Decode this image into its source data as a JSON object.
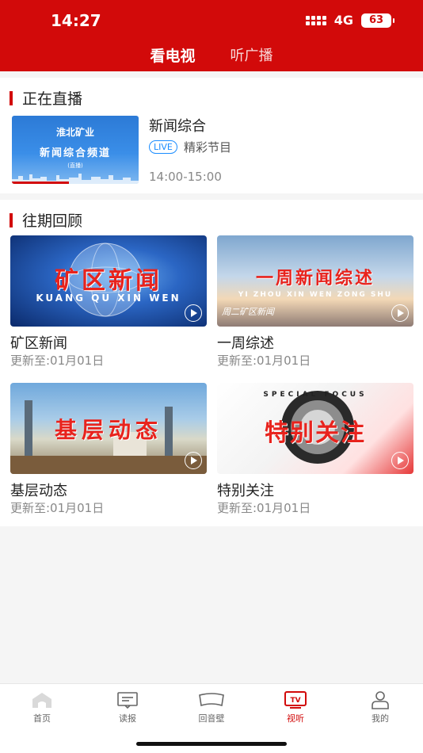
{
  "status_bar": {
    "time": "14:27",
    "network": "4G",
    "battery": "63"
  },
  "header": {
    "tabs": [
      {
        "label": "看电视",
        "active": true
      },
      {
        "label": "听广播",
        "active": false
      }
    ]
  },
  "live": {
    "section_title": "正在直播",
    "thumb": {
      "logo_text": "淮北矿业",
      "channel_text": "新闻综合频道",
      "sub_text": "(直播)"
    },
    "name": "新闻综合",
    "badge": "LIVE",
    "desc": "精彩节目",
    "time": "14:00-15:00"
  },
  "archive": {
    "section_title": "往期回顾",
    "items": [
      {
        "title": "矿区新闻",
        "update": "更新至:01月01日",
        "thumb_title": "矿区新闻",
        "thumb_sub": "KUANG QU XIN WEN"
      },
      {
        "title": "一周综述",
        "update": "更新至:01月01日",
        "thumb_title": "一周新闻综述",
        "thumb_sub": "YI ZHOU XIN WEN ZONG SHU",
        "thumb_sub2": "周二矿区新闻"
      },
      {
        "title": "基层动态",
        "update": "更新至:01月01日",
        "thumb_title": "基层动态"
      },
      {
        "title": "特别关注",
        "update": "更新至:01月01日",
        "thumb_title": "特别关注",
        "thumb_sub": "SPECIAL FOCUS"
      }
    ]
  },
  "bottom_nav": [
    {
      "label": "首页",
      "icon": "home-icon"
    },
    {
      "label": "读报",
      "icon": "newspaper-icon"
    },
    {
      "label": "回音壁",
      "icon": "echo-wall-icon"
    },
    {
      "label": "视听",
      "icon": "tv-icon",
      "active": true
    },
    {
      "label": "我的",
      "icon": "user-icon"
    }
  ],
  "colors": {
    "brand_red": "#d20a0a",
    "live_blue": "#1a8cff",
    "muted": "#888888"
  }
}
